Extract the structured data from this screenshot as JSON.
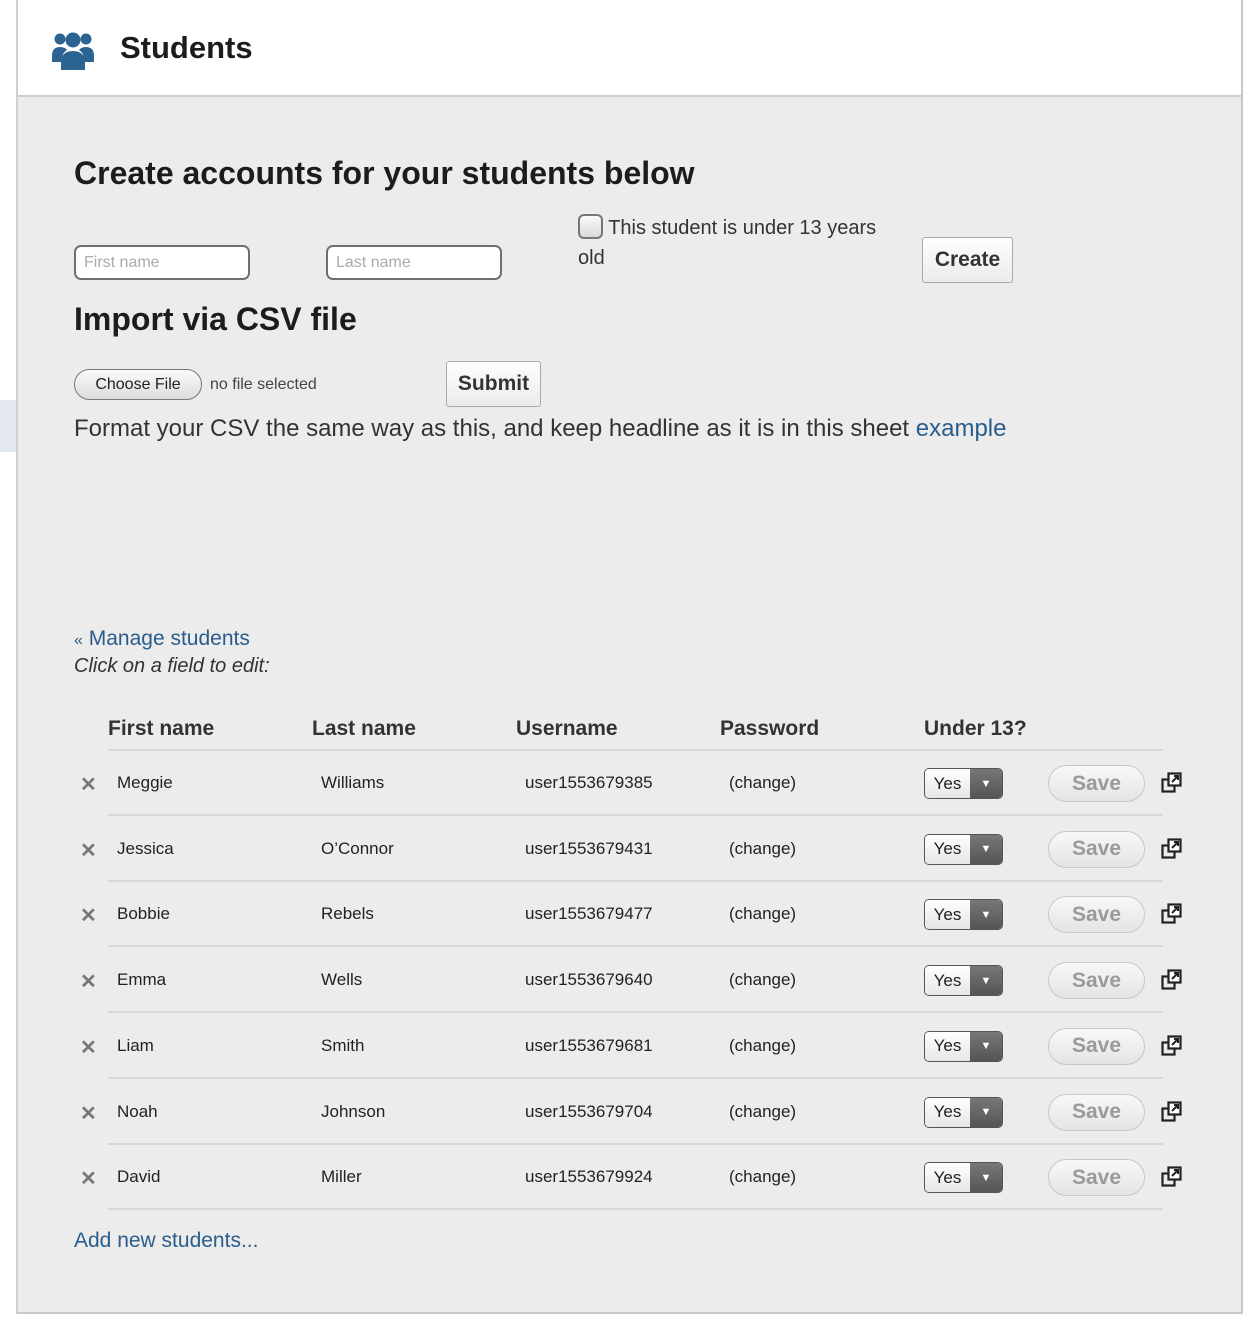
{
  "header": {
    "title": "Students",
    "icon": "users-group-icon",
    "accent_color": "#2b6393"
  },
  "create": {
    "heading": "Create accounts for your students below",
    "first_name_placeholder": "First name",
    "last_name_placeholder": "Last name",
    "first_name_value": "",
    "last_name_value": "",
    "under13_label": "This student is under 13 years old",
    "under13_checked": false,
    "create_label": "Create"
  },
  "import": {
    "heading": "Import via CSV file",
    "choose_file_label": "Choose File",
    "file_status": "no file selected",
    "submit_label": "Submit",
    "format_text": "Format your CSV the same way as this, and keep headline as it is in this sheet",
    "example_link": "example"
  },
  "manage": {
    "link_prefix": "«",
    "link_label": "Manage students",
    "instruction": "Click on a field to edit:"
  },
  "table": {
    "columns": [
      "First name",
      "Last name",
      "Username",
      "Password",
      "Under 13?"
    ],
    "rows": [
      {
        "first": "Meggie",
        "last": "Williams",
        "username": "user1553679385",
        "password": "(change)",
        "under13": "Yes",
        "save": "Save"
      },
      {
        "first": "Jessica",
        "last": "O’Connor",
        "username": "user1553679431",
        "password": "(change)",
        "under13": "Yes",
        "save": "Save"
      },
      {
        "first": "Bobbie",
        "last": "Rebels",
        "username": "user1553679477",
        "password": "(change)",
        "under13": "Yes",
        "save": "Save"
      },
      {
        "first": "Emma",
        "last": "Wells",
        "username": "user1553679640",
        "password": "(change)",
        "under13": "Yes",
        "save": "Save"
      },
      {
        "first": "Liam",
        "last": "Smith",
        "username": "user1553679681",
        "password": "(change)",
        "under13": "Yes",
        "save": "Save"
      },
      {
        "first": "Noah",
        "last": "Johnson",
        "username": "user1553679704",
        "password": "(change)",
        "under13": "Yes",
        "save": "Save"
      },
      {
        "first": "David",
        "last": "Miller",
        "username": "user1553679924",
        "password": "(change)",
        "under13": "Yes",
        "save": "Save"
      }
    ],
    "delete_icon": "close-x-icon",
    "row_action_icon": "external-window-icon"
  },
  "footer": {
    "add_link": "Add new students..."
  }
}
